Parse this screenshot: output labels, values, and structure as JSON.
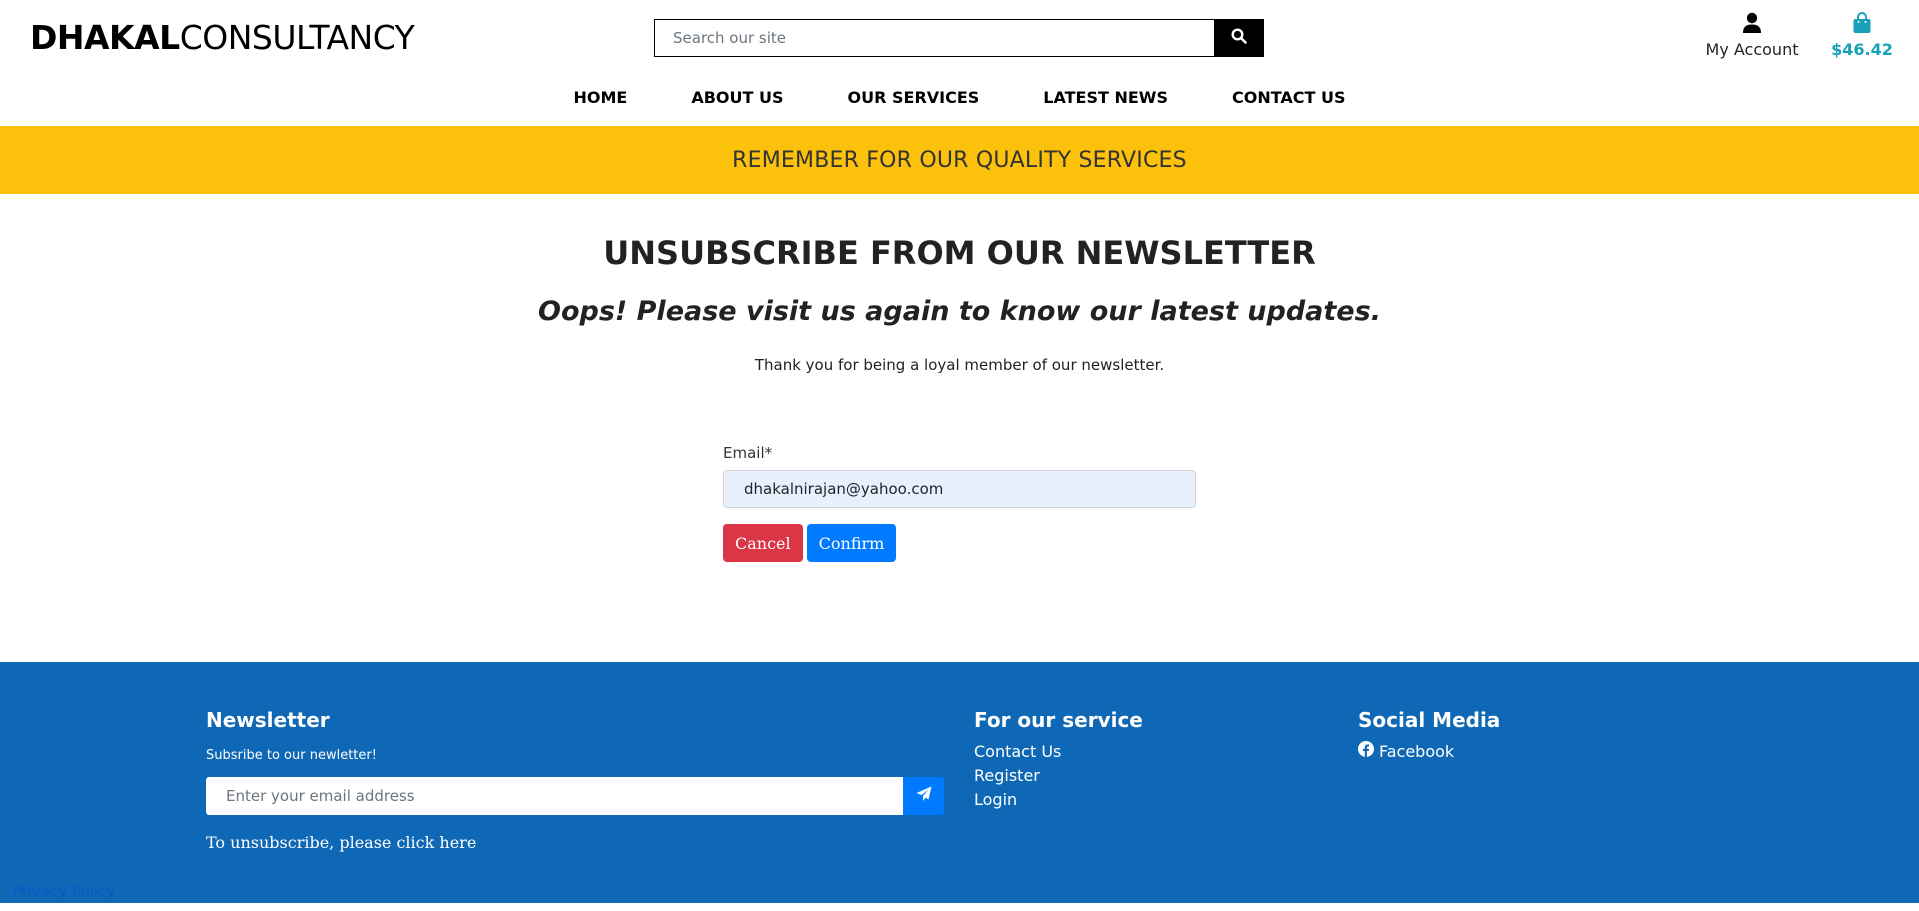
{
  "header": {
    "logo_bold": "DHAKAL",
    "logo_light": "CONSULTANCY",
    "search_placeholder": "Search our site",
    "account_label": "My Account",
    "cart_total": "$46.42",
    "icons": {
      "search": "search-icon",
      "account": "user-icon",
      "cart": "shopping-bag-icon"
    }
  },
  "nav": {
    "items": [
      {
        "label": "HOME"
      },
      {
        "label": "ABOUT US"
      },
      {
        "label": "OUR SERVICES"
      },
      {
        "label": "LATEST NEWS"
      },
      {
        "label": "CONTACT US"
      }
    ]
  },
  "banner": {
    "text": "REMEMBER FOR OUR QUALITY SERVICES"
  },
  "main": {
    "title": "UNSUBSCRIBE FROM OUR NEWSLETTER",
    "subtitle": "Oops! Please visit us again to know our latest updates.",
    "thanks": "Thank you for being a loyal member of our newsletter.",
    "form": {
      "email_label": "Email*",
      "email_value": "dhakalnirajan@yahoo.com",
      "cancel_label": "Cancel",
      "confirm_label": "Confirm"
    }
  },
  "footer": {
    "newsletter": {
      "heading": "Newsletter",
      "sub": "Subsribe to our newletter!",
      "placeholder": "Enter your email address",
      "unsubscribe_text": "To unsubscribe, please click here"
    },
    "service": {
      "heading": "For our service",
      "links": [
        {
          "label": "Contact Us"
        },
        {
          "label": "Register"
        },
        {
          "label": "Login"
        }
      ]
    },
    "social": {
      "heading": "Social Media",
      "links": [
        {
          "label": "Facebook",
          "icon": "facebook-icon"
        }
      ]
    },
    "privacy": "Privacy Policy"
  },
  "colors": {
    "banner": "#fcc10b",
    "footer": "#0f68b5",
    "cancel": "#dc3545",
    "confirm": "#007bff",
    "cart_accent": "#17a2b8"
  }
}
